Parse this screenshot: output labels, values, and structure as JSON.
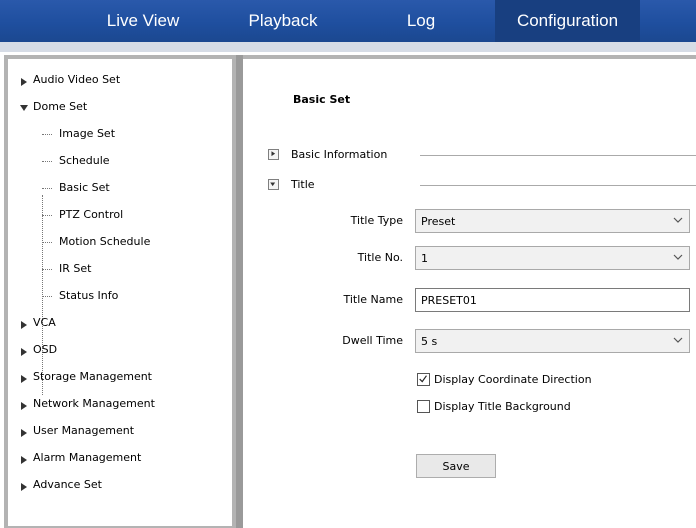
{
  "nav": {
    "tabs": [
      {
        "label": "Live View"
      },
      {
        "label": "Playback"
      },
      {
        "label": "Log"
      },
      {
        "label": "Configuration"
      }
    ],
    "active": "Configuration"
  },
  "sidebar": {
    "items": [
      {
        "label": "Audio Video Set",
        "state": "collapsed"
      },
      {
        "label": "Dome Set",
        "state": "expanded",
        "children": [
          {
            "label": "Image Set"
          },
          {
            "label": "Schedule"
          },
          {
            "label": "Basic Set"
          },
          {
            "label": "PTZ Control"
          },
          {
            "label": "Motion Schedule"
          },
          {
            "label": "IR Set"
          },
          {
            "label": "Status Info"
          }
        ]
      },
      {
        "label": "VCA",
        "state": "collapsed"
      },
      {
        "label": "OSD",
        "state": "collapsed"
      },
      {
        "label": "Storage Management",
        "state": "collapsed"
      },
      {
        "label": "Network Management",
        "state": "collapsed"
      },
      {
        "label": "User Management",
        "state": "collapsed"
      },
      {
        "label": "Alarm Management",
        "state": "collapsed"
      },
      {
        "label": "Advance Set",
        "state": "collapsed"
      }
    ],
    "selected_child": "Basic Set"
  },
  "main": {
    "title": "Basic Set",
    "sections": [
      {
        "label": "Basic Information",
        "state": "collapsed"
      },
      {
        "label": "Title",
        "state": "expanded"
      }
    ],
    "form": {
      "title_type": {
        "label": "Title Type",
        "value": "Preset"
      },
      "title_no": {
        "label": "Title No.",
        "value": "1"
      },
      "title_name": {
        "label": "Title Name",
        "value": "PRESET01"
      },
      "dwell_time": {
        "label": "Dwell Time",
        "value": "5 s"
      },
      "display_coordinate_direction": {
        "label": "Display Coordinate Direction",
        "checked": true
      },
      "display_title_background": {
        "label": "Display Title Background",
        "checked": false
      }
    },
    "save_label": "Save"
  },
  "colors": {
    "nav_bg": "#1f4f9f",
    "nav_active": "#183f80",
    "strip": "#d6dce6",
    "border": "#b3b3b3"
  },
  "icons": {
    "expand": "triangle-right-icon",
    "collapse": "triangle-down-icon",
    "dropdown": "chevron-down-icon",
    "checkbox": "checkmark-icon"
  }
}
